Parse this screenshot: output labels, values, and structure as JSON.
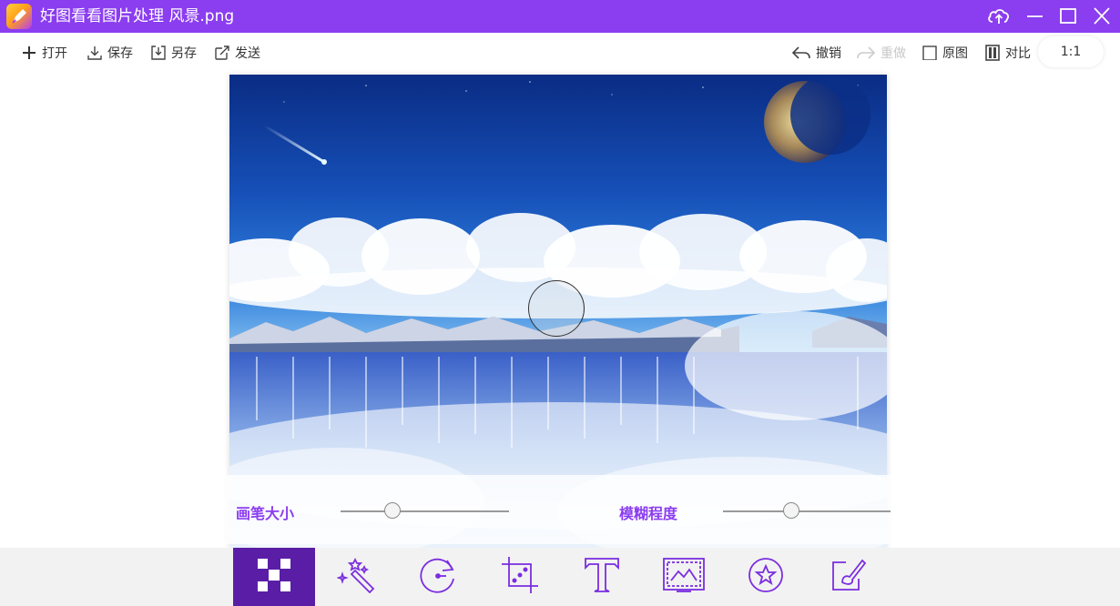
{
  "window": {
    "title": "好图看看图片处理 风景.png",
    "title_bar_color": "#8b3df0",
    "logo_icon": "pen-logo-icon",
    "controls": [
      "upload-cloud-icon",
      "minimize-icon",
      "maximize-icon",
      "close-icon"
    ]
  },
  "toolbar": {
    "open_label": "打开",
    "save_label": "保存",
    "save_as_label": "另存",
    "send_label": "发送",
    "undo_label": "撤销",
    "redo_label": "重做",
    "original_label": "原图",
    "compare_label": "对比",
    "zoom_label": "1:1",
    "redo_disabled": true
  },
  "sliders": {
    "brush_size": {
      "label": "画笔大小",
      "value": 0.31
    },
    "blur_level": {
      "label": "模糊程度",
      "value": 0.41
    }
  },
  "accent_color": "#8b3df0",
  "active_tool_color": "#5a1ea6",
  "tools": [
    {
      "icon": "mosaic-icon",
      "active": true
    },
    {
      "icon": "magic-wand-icon",
      "active": false
    },
    {
      "icon": "rotate-icon",
      "active": false
    },
    {
      "icon": "crop-icon",
      "active": false
    },
    {
      "icon": "text-icon",
      "active": false
    },
    {
      "icon": "frame-icon",
      "active": false
    },
    {
      "icon": "sticker-icon",
      "active": false
    },
    {
      "icon": "doodle-icon",
      "active": false
    }
  ]
}
